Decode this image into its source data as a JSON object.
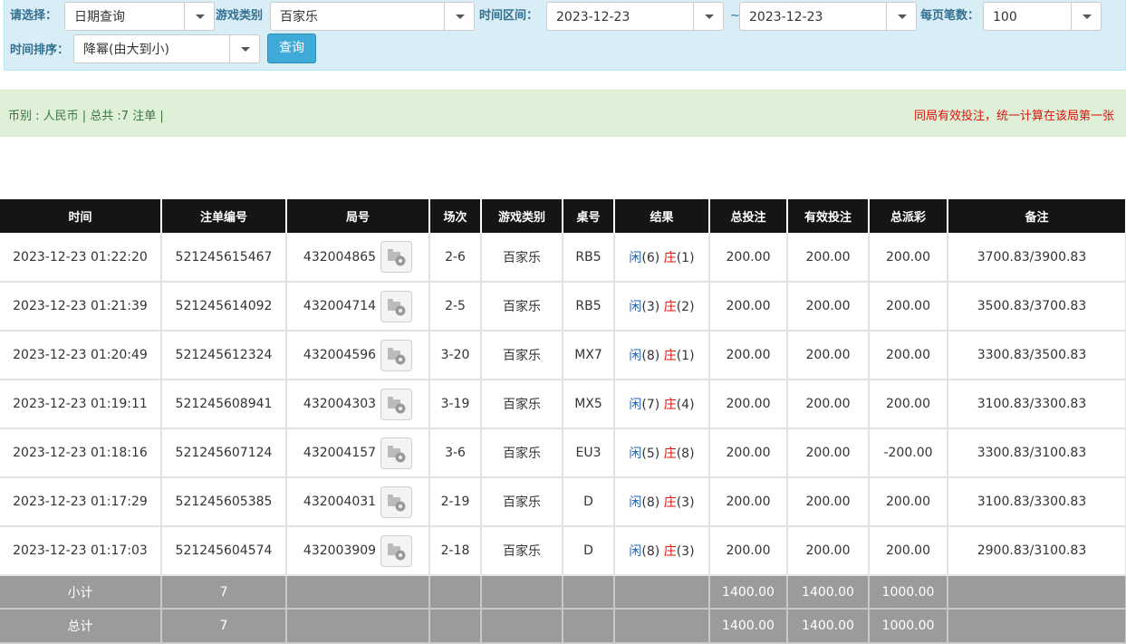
{
  "filters": {
    "select_label": "请选择：",
    "select_value": "日期查询",
    "game_type_label": "游戏类别",
    "game_type_value": "百家乐",
    "time_range_label": "时间区间：",
    "date_from": "2023-12-23",
    "range_sep": "~",
    "date_to": "2023-12-23",
    "per_page_label": "每页笔数：",
    "per_page_value": "100",
    "sort_label": "时间排序：",
    "sort_value": "降幂(由大到小)",
    "query_button": "查询"
  },
  "summary": {
    "left": "币别 : 人民币 | 总共 :7 注单 |",
    "right": "同局有效投注，统一计算在该局第一张"
  },
  "table": {
    "headers": [
      "时间",
      "注单编号",
      "局号",
      "场次",
      "游戏类别",
      "桌号",
      "结果",
      "总投注",
      "有效投注",
      "总派彩",
      "备注"
    ],
    "rows": [
      {
        "time": "2023-12-23 01:22:20",
        "order": "521245615467",
        "round": "432004865",
        "session": "2-6",
        "game": "百家乐",
        "table": "RB5",
        "player_label": "闲",
        "player": "(6)",
        "banker_label": "庄",
        "banker": "(1)",
        "total_bet": "200.00",
        "valid_bet": "200.00",
        "payout": "200.00",
        "note": "3700.83/3900.83"
      },
      {
        "time": "2023-12-23 01:21:39",
        "order": "521245614092",
        "round": "432004714",
        "session": "2-5",
        "game": "百家乐",
        "table": "RB5",
        "player_label": "闲",
        "player": "(3)",
        "banker_label": "庄",
        "banker": "(2)",
        "total_bet": "200.00",
        "valid_bet": "200.00",
        "payout": "200.00",
        "note": "3500.83/3700.83"
      },
      {
        "time": "2023-12-23 01:20:49",
        "order": "521245612324",
        "round": "432004596",
        "session": "3-20",
        "game": "百家乐",
        "table": "MX7",
        "player_label": "闲",
        "player": "(8)",
        "banker_label": "庄",
        "banker": "(1)",
        "total_bet": "200.00",
        "valid_bet": "200.00",
        "payout": "200.00",
        "note": "3300.83/3500.83"
      },
      {
        "time": "2023-12-23 01:19:11",
        "order": "521245608941",
        "round": "432004303",
        "session": "3-19",
        "game": "百家乐",
        "table": "MX5",
        "player_label": "闲",
        "player": "(7)",
        "banker_label": "庄",
        "banker": "(4)",
        "total_bet": "200.00",
        "valid_bet": "200.00",
        "payout": "200.00",
        "note": "3100.83/3300.83"
      },
      {
        "time": "2023-12-23 01:18:16",
        "order": "521245607124",
        "round": "432004157",
        "session": "3-6",
        "game": "百家乐",
        "table": "EU3",
        "player_label": "闲",
        "player": "(5)",
        "banker_label": "庄",
        "banker": "(8)",
        "total_bet": "200.00",
        "valid_bet": "200.00",
        "payout": "-200.00",
        "note": "3300.83/3100.83"
      },
      {
        "time": "2023-12-23 01:17:29",
        "order": "521245605385",
        "round": "432004031",
        "session": "2-19",
        "game": "百家乐",
        "table": "D",
        "player_label": "闲",
        "player": "(8)",
        "banker_label": "庄",
        "banker": "(3)",
        "total_bet": "200.00",
        "valid_bet": "200.00",
        "payout": "200.00",
        "note": "3100.83/3300.83"
      },
      {
        "time": "2023-12-23 01:17:03",
        "order": "521245604574",
        "round": "432003909",
        "session": "2-18",
        "game": "百家乐",
        "table": "D",
        "player_label": "闲",
        "player": "(8)",
        "banker_label": "庄",
        "banker": "(3)",
        "total_bet": "200.00",
        "valid_bet": "200.00",
        "payout": "200.00",
        "note": "2900.83/3100.83"
      }
    ],
    "subtotal": {
      "label": "小计",
      "count": "7",
      "total_bet": "1400.00",
      "valid_bet": "1400.00",
      "payout": "1000.00"
    },
    "total": {
      "label": "总计",
      "count": "7",
      "total_bet": "1400.00",
      "valid_bet": "1400.00",
      "payout": "1000.00"
    }
  },
  "colors": {
    "filter_bg": "#d9edf7",
    "summary_bg": "#dff0d8",
    "header_bg": "#151515",
    "link_blue": "#2266bb",
    "negative_red": "#d9140b",
    "footer_gray": "#9b9b9b"
  },
  "icons": {
    "round_video": "video-replay-icon"
  }
}
